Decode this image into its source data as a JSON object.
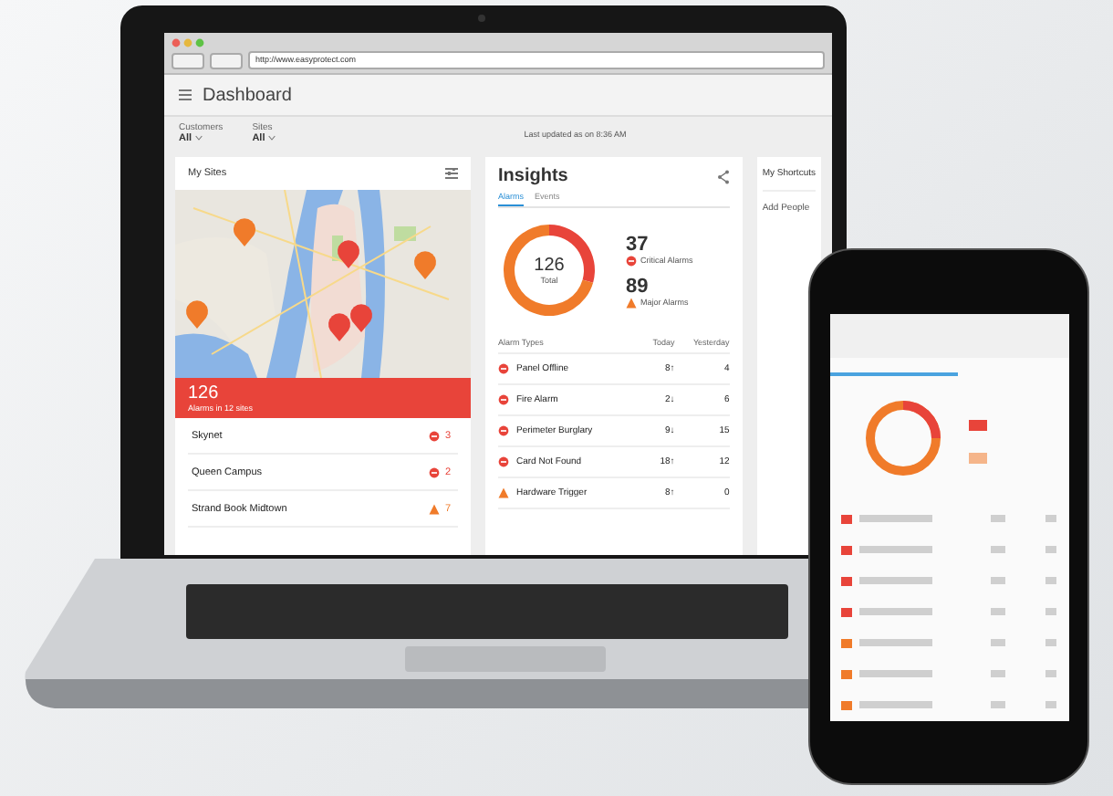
{
  "browser": {
    "url": "http://www.easyprotect.com"
  },
  "app_bar": {
    "title": "Dashboard"
  },
  "filters": [
    {
      "label": "Customers",
      "value": "All"
    },
    {
      "label": "Sites",
      "value": "All"
    }
  ],
  "last_updated": "Last updated as on 8:36 AM",
  "my_sites": {
    "title": "My Sites",
    "total": "126",
    "total_caption": "Alarms in 12 sites",
    "sites": [
      {
        "name": "Skynet",
        "kind": "critical",
        "count": "3"
      },
      {
        "name": "Queen Campus",
        "kind": "critical",
        "count": "2"
      },
      {
        "name": "Strand Book Midtown",
        "kind": "major",
        "count": "7"
      }
    ]
  },
  "insights": {
    "title": "Insights",
    "tabs": [
      {
        "label": "Alarms",
        "selected": true
      },
      {
        "label": "Events",
        "selected": false
      }
    ],
    "total": "126",
    "total_label": "Total",
    "chart_data": {
      "type": "donut",
      "categories": [
        "Critical Alarms",
        "Major Alarms"
      ],
      "values": [
        29.4,
        70.6
      ]
    },
    "legend": [
      {
        "value": "37",
        "kind": "critical"
      },
      {
        "value": "89",
        "kind": "major"
      }
    ],
    "columns": [
      "Alarm Types",
      "Today",
      "Yesterday"
    ],
    "rows": [
      {
        "kind": "critical",
        "type": "Panel Offline",
        "today": "8↑",
        "yesterday": "4"
      },
      {
        "kind": "critical",
        "type": "Fire Alarm",
        "today": "2↓",
        "yesterday": "6"
      },
      {
        "kind": "critical",
        "type": "Perimeter Burglary",
        "today": "9↓",
        "yesterday": "15"
      },
      {
        "kind": "critical",
        "type": "Card Not Found",
        "today": "18↑",
        "yesterday": "12"
      },
      {
        "kind": "major",
        "type": "Hardware Trigger",
        "today": "8↑",
        "yesterday": "0"
      }
    ]
  },
  "shortcuts": {
    "title": "My Shortcuts",
    "items": [
      "Add People"
    ]
  }
}
